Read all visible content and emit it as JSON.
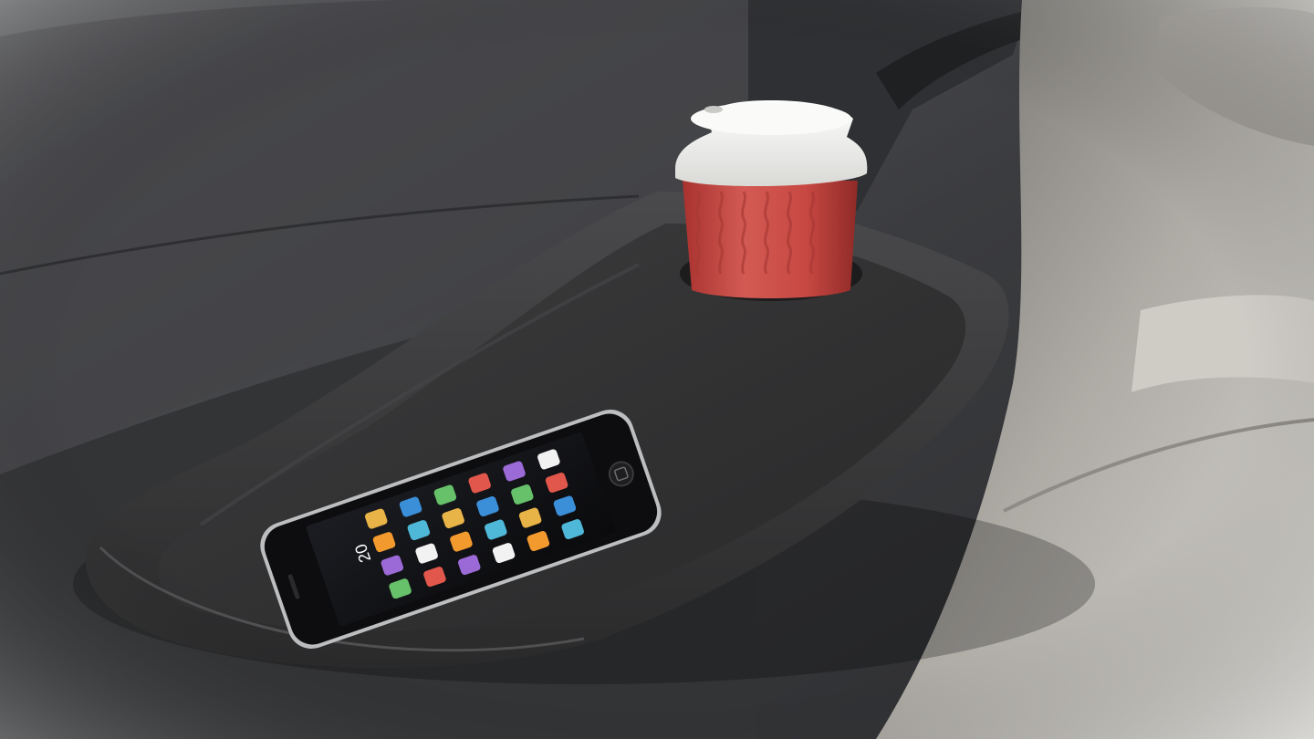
{
  "scene": {
    "description_free": true,
    "colors": {
      "seat_leather_dark": "#3a3b3d",
      "seat_leather_light": "#c9c7c2",
      "tray": "#323233",
      "tray_rim": "#3f3f41",
      "cup_sleeve": "#c94a45",
      "cup_lid": "#f1f1ef",
      "phone_body": "#101010",
      "phone_bezel_silver": "#b9bbbd"
    }
  },
  "phone": {
    "clock_time": "20",
    "app_icon_count": 24
  }
}
